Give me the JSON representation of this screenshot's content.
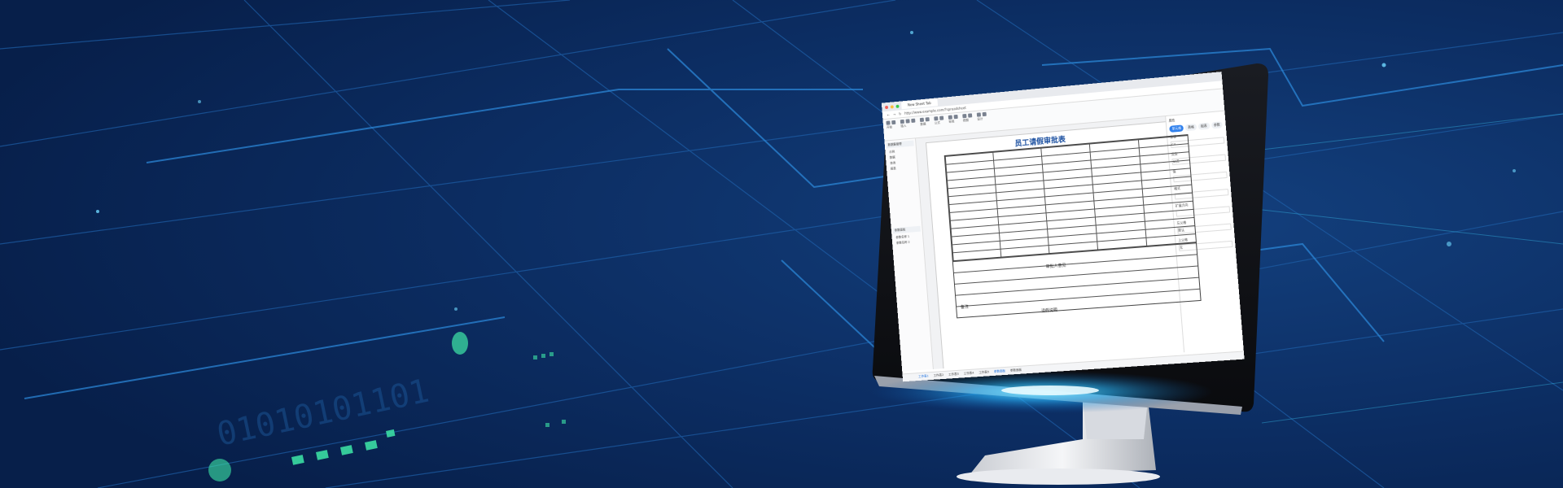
{
  "browser": {
    "tab_title": "New Sheet Tab",
    "address": "http://www.example.com/?spreadsheet"
  },
  "ribbon": {
    "tabs": [
      "开始",
      "插入",
      "数据",
      "公式",
      "审阅",
      "视图",
      "设计"
    ]
  },
  "left_panel": {
    "title": "数据集管理",
    "items": [
      "示例",
      "数据",
      "查询",
      "报表"
    ],
    "bottom_title": "参数面板",
    "params": [
      "参数名称 1",
      "参数名称 2"
    ]
  },
  "sheet": {
    "form_title": "员工请假审批表",
    "section_labels": [
      "审批人意见",
      "备注",
      "请假说明"
    ]
  },
  "right_panel": {
    "title": "属性",
    "tabs": [
      "单元格",
      "表格",
      "报表",
      "参数"
    ],
    "fields": [
      {
        "label": "坐标",
        "value": "C4"
      },
      {
        "label": "类型",
        "value": "公式"
      },
      {
        "label": "值",
        "value": ""
      },
      {
        "label": "格式",
        "value": ""
      },
      {
        "label": "扩展方向",
        "value": ""
      },
      {
        "label": "左父格",
        "value": "默认"
      },
      {
        "label": "上父格",
        "value": "无"
      }
    ]
  },
  "sheet_tabs": [
    "工作表1",
    "工作表2",
    "工作表3",
    "工作表4",
    "工作表5",
    "参数面板",
    "参数面板"
  ],
  "colors": {
    "background": "#0b2a5a",
    "grid_line": "#1e6fb8",
    "accent_cyan": "#3fd4ff",
    "accent_green": "#3ee8a8",
    "title_blue": "#1a4fa0"
  }
}
